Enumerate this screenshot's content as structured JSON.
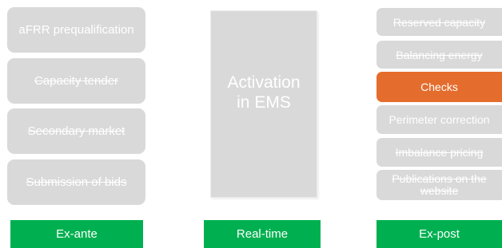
{
  "ex_ante": {
    "items": [
      {
        "label": "aFRR prequalification"
      },
      {
        "label": "Capacity tender"
      },
      {
        "label": "Secondary market"
      },
      {
        "label": "Submission of bids"
      }
    ],
    "phase_label": "Ex-ante"
  },
  "real_time": {
    "line1": "Activation",
    "line2": "in EMS",
    "phase_label": "Real-time"
  },
  "ex_post": {
    "items": [
      {
        "label": "Reserved capacity"
      },
      {
        "label": "Balancing energy"
      },
      {
        "label": "Checks"
      },
      {
        "label": "Perimeter correction"
      },
      {
        "label": "Imbalance pricing"
      },
      {
        "label": "Publications on the website"
      }
    ],
    "phase_label": "Ex-post"
  },
  "colors": {
    "box_grey": "#d9d9d9",
    "highlight_orange": "#e46c2c",
    "phase_green": "#00b050"
  }
}
